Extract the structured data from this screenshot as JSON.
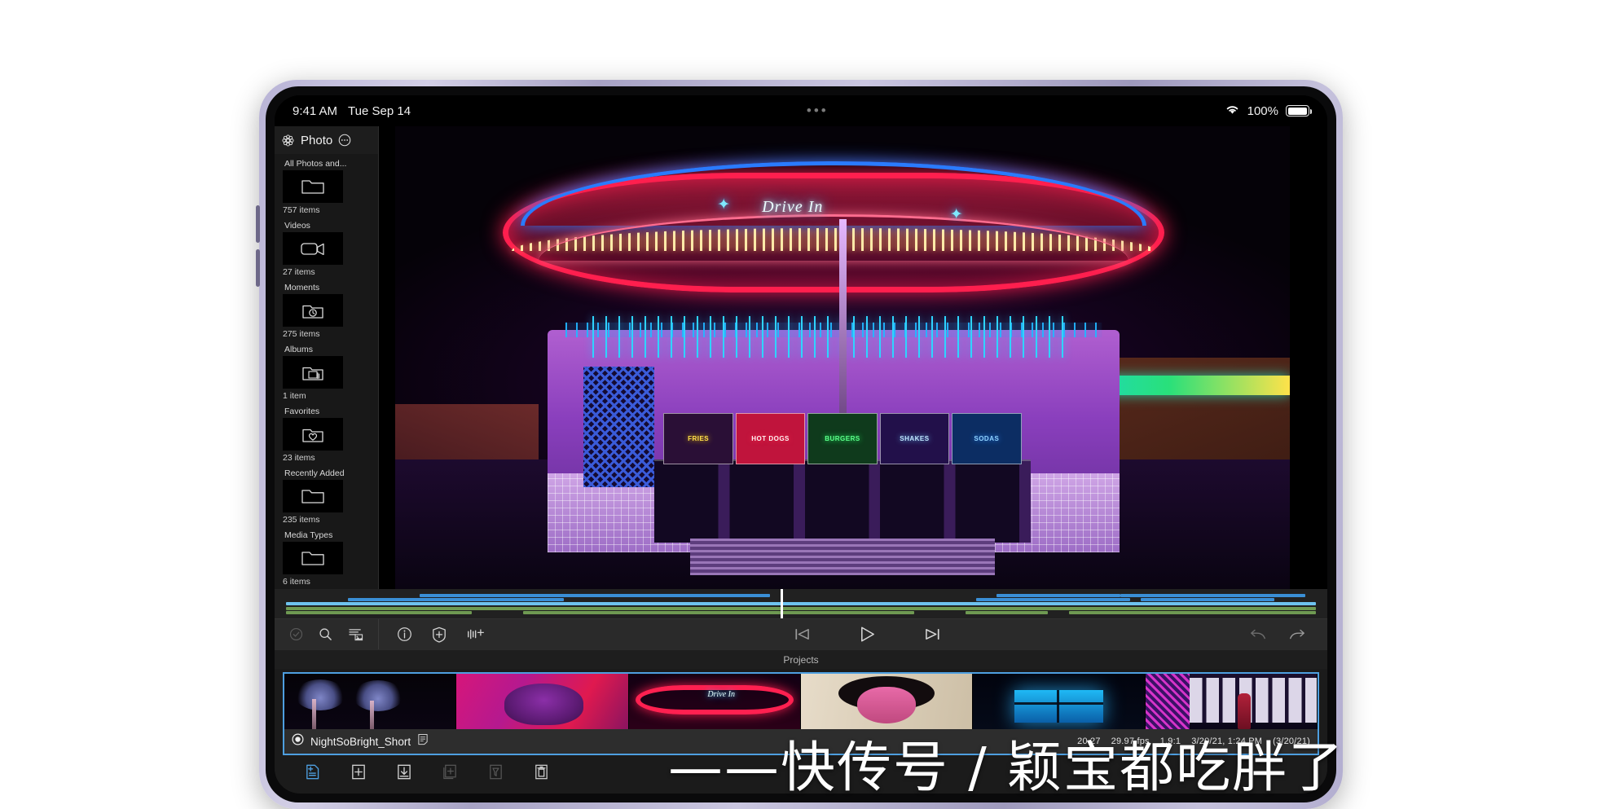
{
  "device": {
    "kind": "tablet"
  },
  "status_bar": {
    "time": "9:41 AM",
    "date": "Tue Sep 14",
    "battery_percent": "100%",
    "wifi_icon": "wifi-icon",
    "dots": "•••"
  },
  "sidebar": {
    "title": "Photo",
    "flower_icon": "flower-icon",
    "more_icon": "ellipsis-circle-icon",
    "items": [
      {
        "label": "All Photos and...",
        "count": "757 items",
        "icon": "folder-icon"
      },
      {
        "label": "Videos",
        "count": "27 items",
        "icon": "video-camera-icon"
      },
      {
        "label": "Moments",
        "count": "275 items",
        "icon": "folder-clock-icon"
      },
      {
        "label": "Albums",
        "count": "1 item",
        "icon": "folder-stack-icon"
      },
      {
        "label": "Favorites",
        "count": "23 items",
        "icon": "folder-heart-icon"
      },
      {
        "label": "Recently Added",
        "count": "235 items",
        "icon": "folder-icon"
      },
      {
        "label": "Media Types",
        "count": "6 items",
        "icon": "folder-icon"
      }
    ],
    "footer_icons": [
      {
        "name": "checkmark-circle-icon",
        "enabled": false
      },
      {
        "name": "search-icon",
        "enabled": true
      },
      {
        "name": "filter-list-icon",
        "enabled": true
      }
    ]
  },
  "viewer": {
    "scene_signs": {
      "marquee": "Drive In",
      "shops": [
        "FRIES",
        "HOT DOGS",
        "BURGERS",
        "SHAKES",
        "SODAS"
      ]
    }
  },
  "timeline": {
    "playhead_percent": 48,
    "tracks": [
      {
        "color": "#3a8fd6",
        "row": 0,
        "segments": [
          [
            13,
            13
          ],
          [
            25,
            22
          ],
          [
            69,
            12
          ],
          [
            81,
            18
          ]
        ]
      },
      {
        "color": "#3a8fd6",
        "row": 1,
        "segments": [
          [
            6,
            21
          ],
          [
            67,
            15
          ],
          [
            83,
            13
          ]
        ]
      },
      {
        "color": "#6ec3ef",
        "row": 2,
        "segments": [
          [
            0,
            100
          ]
        ]
      },
      {
        "color": "#6f9a52",
        "row": 3,
        "segments": [
          [
            0,
            100
          ]
        ]
      },
      {
        "color": "#6f9a52",
        "row": 4,
        "segments": [
          [
            0,
            18
          ],
          [
            23,
            38
          ],
          [
            66,
            8
          ],
          [
            76,
            24
          ]
        ]
      }
    ]
  },
  "transport": {
    "left_tools": [
      {
        "name": "info-circle-icon"
      },
      {
        "name": "badge-plus-icon"
      },
      {
        "name": "audio-enhance-icon"
      }
    ],
    "playback": [
      {
        "name": "skip-to-start-icon",
        "glyph": "skip-back"
      },
      {
        "name": "play-button",
        "glyph": "play"
      },
      {
        "name": "skip-to-end-icon",
        "glyph": "skip-forward"
      }
    ],
    "right_tools": [
      {
        "name": "undo-icon"
      },
      {
        "name": "redo-icon"
      }
    ]
  },
  "projects": {
    "header": "Projects",
    "selected_clip": {
      "name": "NightSoBright_Short",
      "radio_icon": "radio-selected-icon",
      "notes_icon": "notes-icon",
      "meta": [
        "20.27",
        "29.97 fps",
        "1.9:1",
        "3/20/21, 1:24 PM",
        "(3/20/21)"
      ]
    },
    "filmstrip_frames": [
      {
        "name": "palm-trees-frame"
      },
      {
        "name": "portrait-pink-frame"
      },
      {
        "name": "drive-in-neon-frame"
      },
      {
        "name": "afro-portrait-frame"
      },
      {
        "name": "blue-window-frame"
      },
      {
        "name": "street-night-frame"
      }
    ]
  },
  "bottom_toolbar": {
    "items": [
      {
        "name": "import-media-icon",
        "active": true,
        "enabled": true
      },
      {
        "name": "new-project-icon",
        "active": false,
        "enabled": true
      },
      {
        "name": "download-icon",
        "active": false,
        "enabled": true
      },
      {
        "name": "duplicate-icon",
        "active": false,
        "enabled": false
      },
      {
        "name": "filter-icon",
        "active": false,
        "enabled": false
      },
      {
        "name": "delete-trash-icon",
        "active": false,
        "enabled": true
      }
    ]
  },
  "watermark": {
    "text": "——快传号 / 颖宝都吃胖了"
  },
  "colors": {
    "accent_blue": "#4e9fe0",
    "timeline_blue": "#6ec3ef",
    "timeline_green": "#6f9a52",
    "panel_dark": "#1b1b1b"
  }
}
